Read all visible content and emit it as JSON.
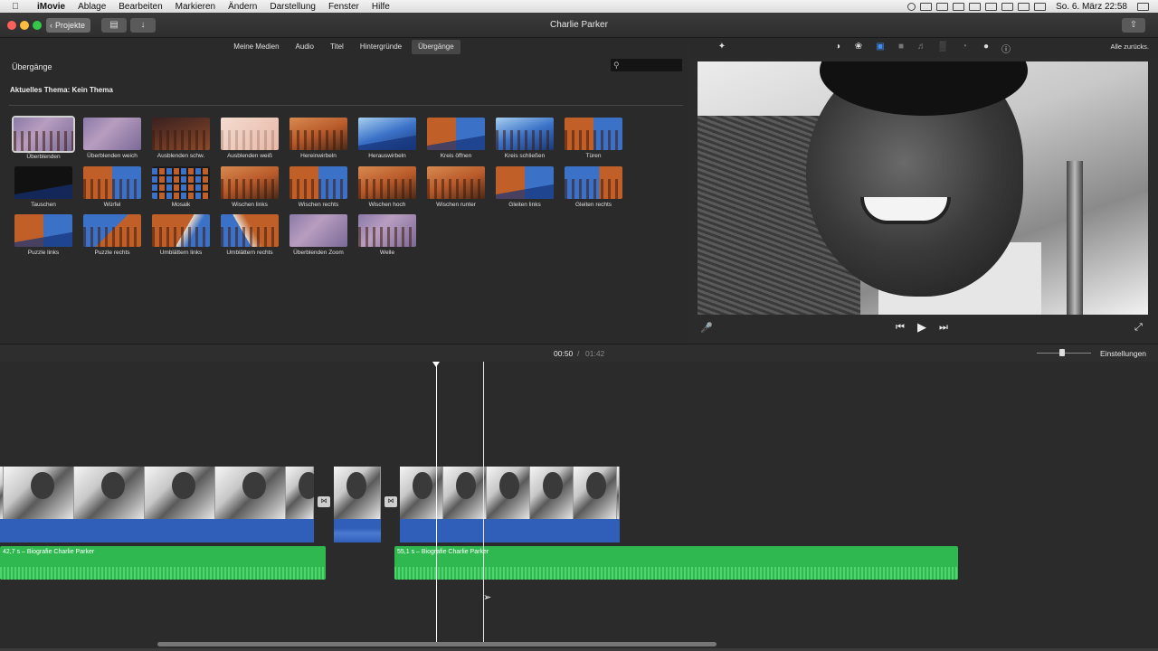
{
  "menubar": {
    "app_name": "iMovie",
    "items": [
      "Ablage",
      "Bearbeiten",
      "Markieren",
      "Ändern",
      "Darstellung",
      "Fenster",
      "Hilfe"
    ],
    "clock": "So. 6. März  22:58"
  },
  "window": {
    "title": "Charlie Parker",
    "projects_button": "Projekte"
  },
  "browser": {
    "tabs": [
      {
        "label": "Meine Medien",
        "active": false
      },
      {
        "label": "Audio",
        "active": false
      },
      {
        "label": "Titel",
        "active": false
      },
      {
        "label": "Hintergründe",
        "active": false
      },
      {
        "label": "Übergänge",
        "active": true
      }
    ],
    "section_title": "Übergänge",
    "theme_label": "Aktuelles Thema: Kein Thema",
    "transitions": [
      {
        "label": "Überblenden",
        "selected": true
      },
      {
        "label": "Überblenden weich"
      },
      {
        "label": "Ausblenden schw."
      },
      {
        "label": "Ausblenden weiß"
      },
      {
        "label": "Hereinwirbeln"
      },
      {
        "label": "Herauswirbeln"
      },
      {
        "label": "Kreis öffnen"
      },
      {
        "label": "Kreis schließen"
      },
      {
        "label": "Türen"
      },
      {
        "label": "Tauschen"
      },
      {
        "label": "Würfel"
      },
      {
        "label": "Mosaik"
      },
      {
        "label": "Wischen links"
      },
      {
        "label": "Wischen rechts"
      },
      {
        "label": "Wischen hoch"
      },
      {
        "label": "Wischen runter"
      },
      {
        "label": "Gleiten links"
      },
      {
        "label": "Gleiten rechts"
      },
      {
        "label": "Puzzle links"
      },
      {
        "label": "Puzzle rechts"
      },
      {
        "label": "Umblättern links"
      },
      {
        "label": "Umblättern rechts"
      },
      {
        "label": "Überblenden Zoom"
      },
      {
        "label": "Welle"
      }
    ]
  },
  "viewer": {
    "reset_label": "Alle zurücks."
  },
  "timeline": {
    "current_time": "00:50",
    "separator": "/",
    "total_time": "01:42",
    "settings_label": "Einstellungen",
    "music_clips": [
      {
        "label": "42,7 s – Biografie Charlie Parker"
      },
      {
        "label": "55,1 s – Biografie Charlie Parker"
      }
    ]
  }
}
